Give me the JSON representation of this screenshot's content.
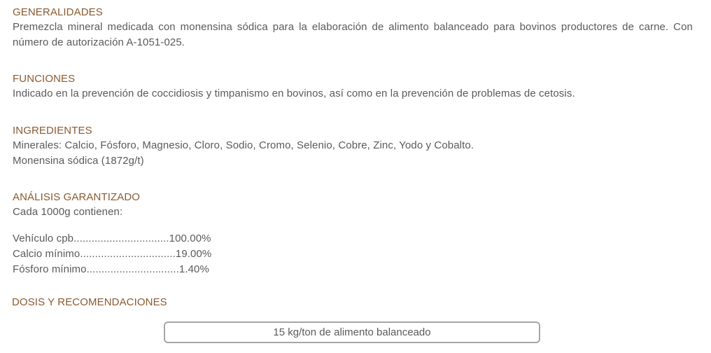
{
  "generalidades": {
    "heading": "GENERALIDADES",
    "body": "Premezcla mineral medicada con monensina sódica para la elaboración de alimento balanceado para bovinos productores de carne. Con número de autorización A-1051-025."
  },
  "funciones": {
    "heading": "FUNCIONES",
    "body": "Indicado en la prevención de coccidiosis y timpanismo en bovinos, así como en la prevención de problemas de cetosis."
  },
  "ingredientes": {
    "heading": "INGREDIENTES",
    "line1": "Minerales: Calcio, Fósforo, Magnesio, Cloro, Sodio, Cromo, Selenio, Cobre, Zinc, Yodo y Cobalto.",
    "line2": "Monensina sódica (1872g/t)"
  },
  "analisis": {
    "heading": "ANÁLISIS GARANTIZADO",
    "intro": "Cada 1000g contienen:",
    "rows": [
      "Vehículo cpb................................100.00%",
      "Calcio mínimo................................19.00%",
      "Fósforo mínimo...............................1.40%"
    ]
  },
  "dosis": {
    "heading": "DOSIS Y RECOMENDACIONES",
    "box_text": "15 kg/ton de alimento balanceado"
  },
  "colors": {
    "heading": "#8a5a30",
    "body": "#5a5a5a",
    "box_border": "#a6a6a6"
  }
}
